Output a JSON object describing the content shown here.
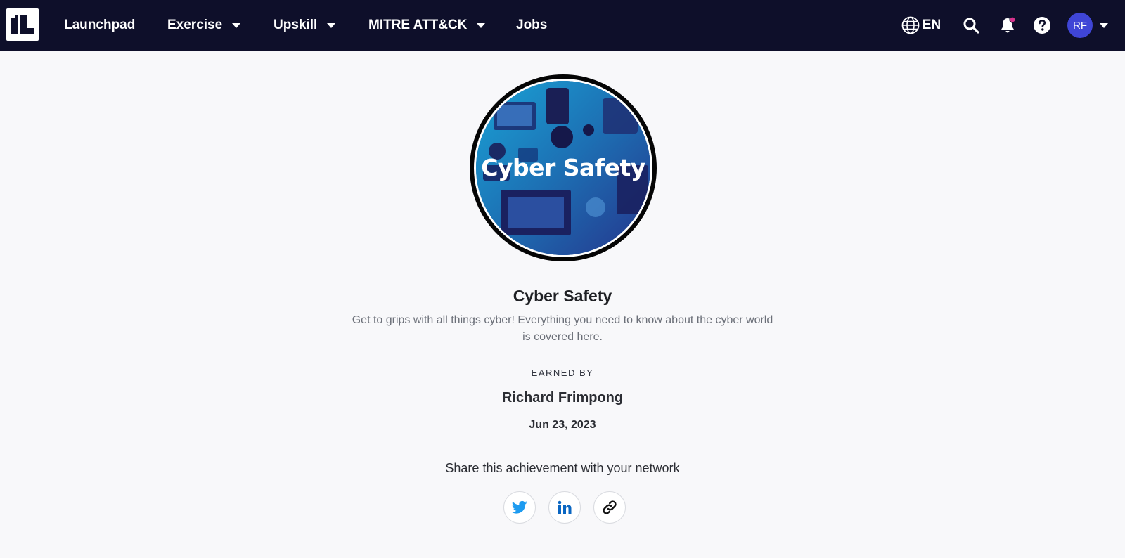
{
  "nav": {
    "logo_text": "IL",
    "items": [
      {
        "label": "Launchpad",
        "has_dropdown": false
      },
      {
        "label": "Exercise",
        "has_dropdown": true
      },
      {
        "label": "Upskill",
        "has_dropdown": true
      },
      {
        "label": "MITRE ATT&CK",
        "has_dropdown": true
      },
      {
        "label": "Jobs",
        "has_dropdown": false
      }
    ],
    "language": "EN",
    "avatar_initials": "RF",
    "icons": [
      "globe-icon",
      "search-icon",
      "bell-icon",
      "help-icon",
      "chevron-down-icon"
    ],
    "has_notification": true
  },
  "badge": {
    "image_text": "Cyber Safety",
    "title": "Cyber Safety",
    "description": "Get to grips with all things cyber! Everything you need to know about the cyber world is covered here.",
    "earned_label": "EARNED BY",
    "earner_name": "Richard Frimpong",
    "date": "Jun 23, 2023"
  },
  "share": {
    "prompt": "Share this achievement with your network",
    "buttons": [
      "twitter",
      "linkedin",
      "copy-link"
    ]
  },
  "colors": {
    "nav_bg": "#0e0f2a",
    "avatar_bg": "#3f45d6",
    "notification_dot": "#d6338c",
    "twitter": "#1d9bf0",
    "linkedin": "#0a66c2",
    "page_bg": "#f8f8fa"
  }
}
